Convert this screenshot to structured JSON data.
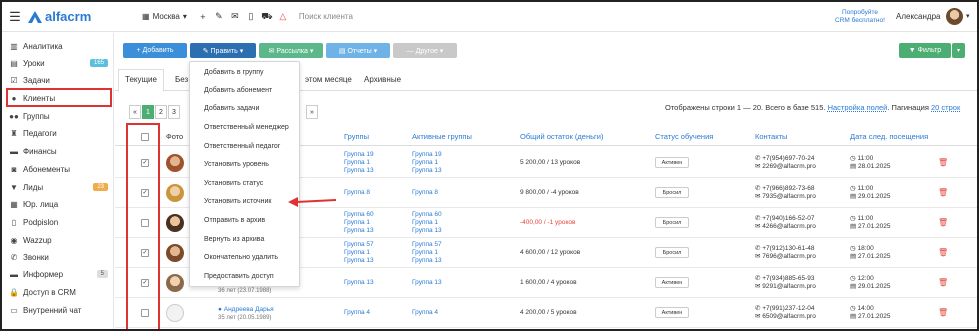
{
  "topbar": {
    "logo_text": "alfacrm",
    "city": "Москва",
    "search_placeholder": "Поиск клиента",
    "promo_line1": "Попробуйте",
    "promo_line2": "CRM бесплатно!",
    "user_name": "Александра"
  },
  "sidebar": {
    "items": [
      {
        "label": "Аналитика",
        "icon": "chart-icon"
      },
      {
        "label": "Уроки",
        "icon": "calendar-icon",
        "badge": "165"
      },
      {
        "label": "Задачи",
        "icon": "tasks-icon"
      },
      {
        "label": "Клиенты",
        "icon": "user-icon"
      },
      {
        "label": "Группы",
        "icon": "users-icon"
      },
      {
        "label": "Педагоги",
        "icon": "teacher-icon"
      },
      {
        "label": "Финансы",
        "icon": "money-icon"
      },
      {
        "label": "Абонементы",
        "icon": "ticket-icon"
      },
      {
        "label": "Лиды",
        "icon": "funnel-icon",
        "badge": "23"
      },
      {
        "label": "Юр. лица",
        "icon": "building-icon"
      },
      {
        "label": "Podpislon",
        "icon": "doc-icon"
      },
      {
        "label": "Wazzup",
        "icon": "whatsapp-icon"
      },
      {
        "label": "Звонки",
        "icon": "phone-icon"
      },
      {
        "label": "Информер",
        "icon": "mail-icon",
        "badge": "5"
      },
      {
        "label": "Доступ в CRM",
        "icon": "lock-icon"
      },
      {
        "label": "Внутренний чат",
        "icon": "chat-icon"
      }
    ]
  },
  "toolbar": {
    "add": "+ Добавить",
    "edit": "✎ Править ▾",
    "mailing": "✉ Рассылка ▾",
    "reports": "▤ Отчеты ▾",
    "other": "— Другое ▾",
    "filter": "▼ Фильтр"
  },
  "tabs": [
    "Текущие",
    "Без",
    "этом месяце",
    "Архивные"
  ],
  "pager": [
    "«",
    "1",
    "2",
    "3",
    "»"
  ],
  "info": {
    "text": "Отображены строки 1 — 20. Всего в базе 515.",
    "settings": "Настройка полей",
    "pagination": "Пагинация",
    "page_size": "20 строк"
  },
  "columns": {
    "photo": "Фото",
    "groups": "Группы",
    "active_groups": "Активные группы",
    "balance": "Общий остаток (деньги)",
    "status": "Статус обучения",
    "contacts": "Контакты",
    "next_visit": "Дата след. посещения"
  },
  "rows": [
    {
      "checked": true,
      "groups": [
        "Группа 19",
        "Группа 1",
        "Группа 13"
      ],
      "active": [
        "Группа 19",
        "Группа 1",
        "Группа 13"
      ],
      "balance": "5 200,00 / 13 уроков",
      "status": "Активен",
      "phone": "+7(954)697-70-24",
      "email": "2269@alfacrm.pro",
      "time": "11:00",
      "date": "28.01.2025"
    },
    {
      "checked": true,
      "groups": [
        "Группа 8"
      ],
      "active": [
        "Группа 8"
      ],
      "balance": "9 800,00 / -4 уроков",
      "status": "Бросил",
      "phone": "+7(966)892-73-68",
      "email": "7935@alfacrm.pro",
      "time": "11:00",
      "date": "29.01.2025"
    },
    {
      "checked": false,
      "groups": [
        "Группа 60",
        "Группа 1",
        "Группа 13"
      ],
      "active": [
        "Группа 60",
        "Группа 1",
        "Группа 13"
      ],
      "balance": "-400,00 / -1 уроков",
      "status": "Бросил",
      "phone": "+7(940)166-52-07",
      "email": "4266@alfacrm.pro",
      "time": "11:00",
      "date": "27.01.2025"
    },
    {
      "checked": true,
      "groups": [
        "Группа 57",
        "Группа 1",
        "Группа 13"
      ],
      "active": [
        "Группа 57",
        "Группа 1",
        "Группа 13"
      ],
      "balance": "4 600,00 / 12 уроков",
      "status": "Бросил",
      "phone": "+7(912)130-61-48",
      "email": "7696@alfacrm.pro",
      "time": "18:00",
      "date": "27.01.2025"
    },
    {
      "checked": true,
      "groups": [
        "Группа 13"
      ],
      "active": [
        "Группа 13"
      ],
      "balance": "1 600,00 / 4 уроков",
      "status": "Активен",
      "phone": "+7(934)885-65-93",
      "email": "9291@alfacrm.pro",
      "time": "12:00",
      "date": "29.01.2025",
      "age": "36 лет (23.07.1988)"
    },
    {
      "checked": false,
      "groups": [
        "Группа 4"
      ],
      "active": [
        "Группа 4"
      ],
      "balance": "4 200,00 / 5 уроков",
      "status": "Активен",
      "phone": "+7(991)237-12-04",
      "email": "6509@alfacrm.pro",
      "time": "14:00",
      "date": "27.01.2025",
      "name": "Андреева Дарья",
      "age": "35 лет (20.05.1989)"
    }
  ],
  "dropdown": [
    "Добавить в группу",
    "Добавить абонемент",
    "Добавить задачи",
    "Ответственный менеджер",
    "Ответственный педагог",
    "Установить уровень",
    "Установить статус",
    "Установить источник",
    "Отправить в архив",
    "Вернуть из архива",
    "Окончательно удалить",
    "Предоставить доступ"
  ]
}
